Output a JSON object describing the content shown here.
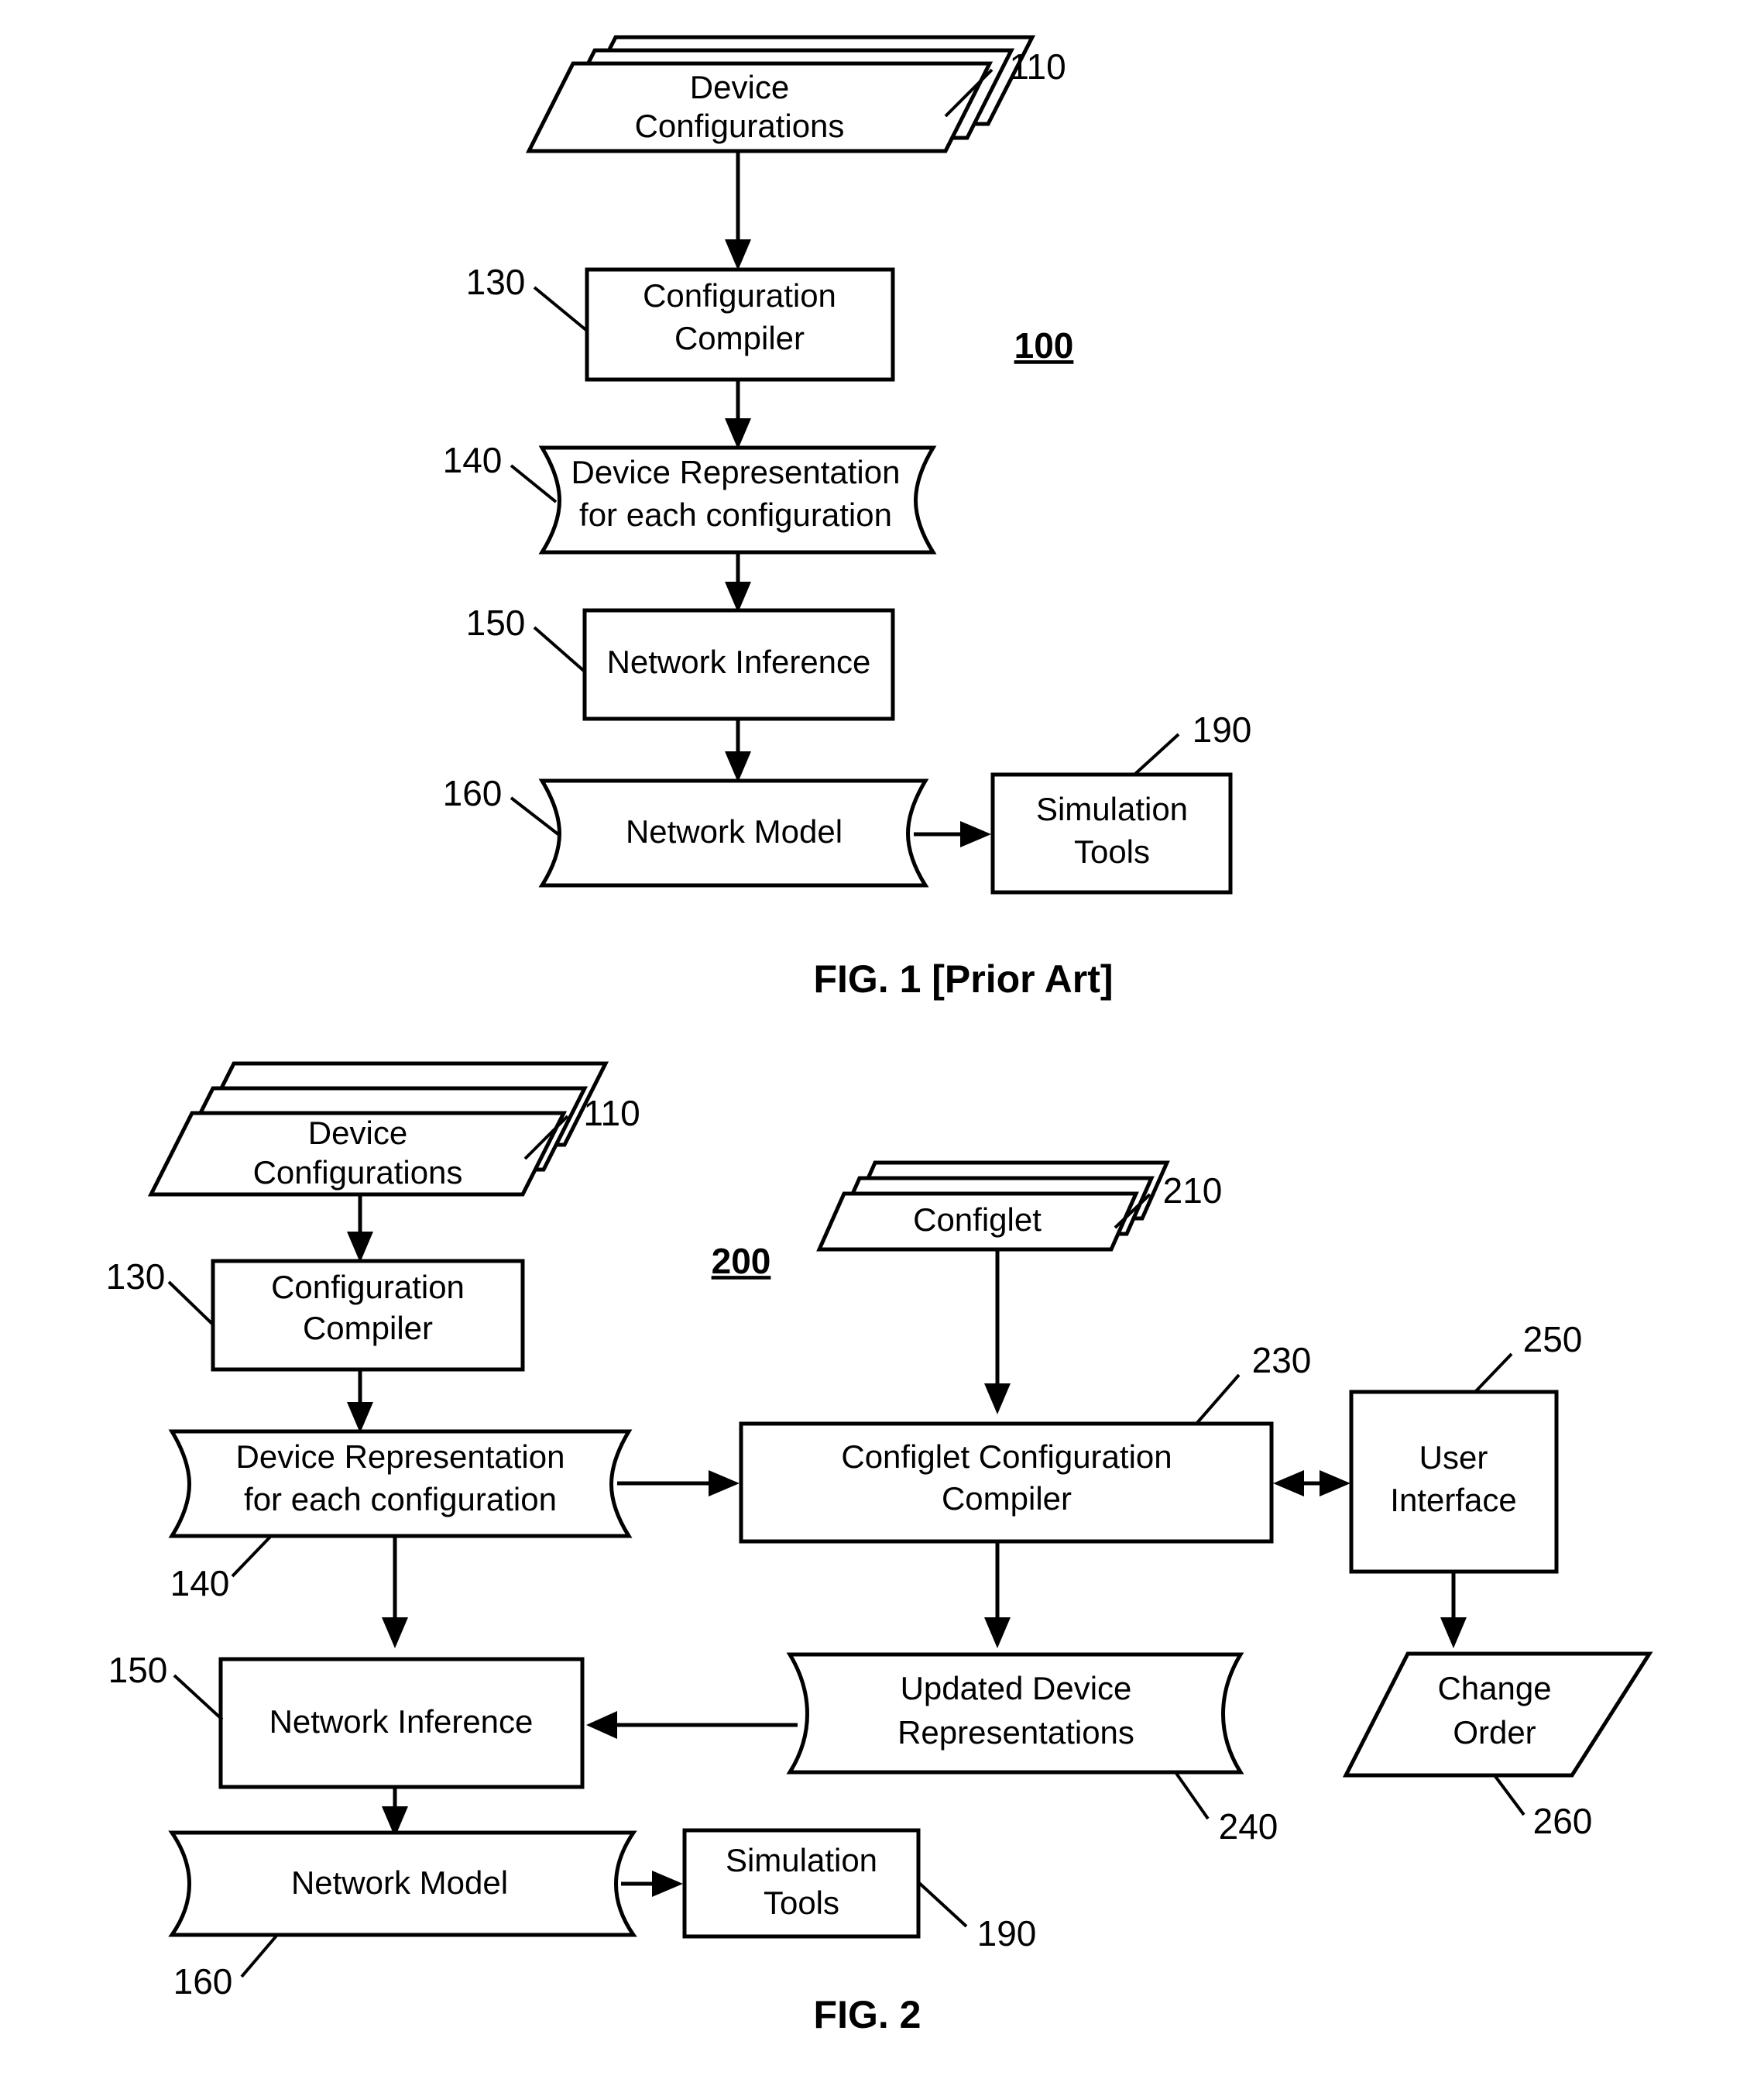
{
  "document": {
    "type": "patent-drawing-sheet",
    "figures": [
      {
        "id": "fig1",
        "caption": "FIG. 1   [Prior Art]",
        "system_number": "100",
        "nodes": [
          {
            "ref": "110",
            "label_line1": "Device",
            "label_line2": "Configurations",
            "shape": "stacked-parallelogram"
          },
          {
            "ref": "130",
            "label_line1": "Configuration",
            "label_line2": "Compiler",
            "shape": "rectangle"
          },
          {
            "ref": "140",
            "label_line1": "Device Representation",
            "label_line2": "for each configuration",
            "shape": "ribbon"
          },
          {
            "ref": "150",
            "label_line1": "Network Inference",
            "label_line2": "",
            "shape": "rectangle"
          },
          {
            "ref": "160",
            "label_line1": "Network Model",
            "label_line2": "",
            "shape": "ribbon"
          },
          {
            "ref": "190",
            "label_line1": "Simulation",
            "label_line2": "Tools",
            "shape": "rectangle"
          }
        ],
        "edges": [
          {
            "from": "110",
            "to": "130",
            "style": "arrow-down"
          },
          {
            "from": "130",
            "to": "140",
            "style": "arrow-down"
          },
          {
            "from": "140",
            "to": "150",
            "style": "arrow-down"
          },
          {
            "from": "150",
            "to": "160",
            "style": "arrow-down"
          },
          {
            "from": "160",
            "to": "190",
            "style": "arrow-right"
          }
        ]
      },
      {
        "id": "fig2",
        "caption": "FIG. 2",
        "system_number": "200",
        "nodes": [
          {
            "ref": "110",
            "label_line1": "Device",
            "label_line2": "Configurations",
            "shape": "stacked-parallelogram"
          },
          {
            "ref": "130",
            "label_line1": "Configuration",
            "label_line2": "Compiler",
            "shape": "rectangle"
          },
          {
            "ref": "140",
            "label_line1": "Device Representation",
            "label_line2": "for each configuration",
            "shape": "ribbon"
          },
          {
            "ref": "210",
            "label_line1": "Configlet",
            "label_line2": "",
            "shape": "stacked-parallelogram"
          },
          {
            "ref": "230",
            "label_line1": "Configlet Configuration",
            "label_line2": "Compiler",
            "shape": "rectangle"
          },
          {
            "ref": "250",
            "label_line1": "User",
            "label_line2": "Interface",
            "shape": "rectangle"
          },
          {
            "ref": "240",
            "label_line1": "Updated Device",
            "label_line2": "Representations",
            "shape": "ribbon"
          },
          {
            "ref": "260",
            "label_line1": "Change",
            "label_line2": "Order",
            "shape": "parallelogram"
          },
          {
            "ref": "150",
            "label_line1": "Network Inference",
            "label_line2": "",
            "shape": "rectangle"
          },
          {
            "ref": "160",
            "label_line1": "Network Model",
            "label_line2": "",
            "shape": "ribbon"
          },
          {
            "ref": "190",
            "label_line1": "Simulation",
            "label_line2": "Tools",
            "shape": "rectangle"
          }
        ],
        "edges": [
          {
            "from": "110",
            "to": "130",
            "style": "arrow-down"
          },
          {
            "from": "130",
            "to": "140",
            "style": "arrow-down"
          },
          {
            "from": "140",
            "to": "230",
            "style": "arrow-right"
          },
          {
            "from": "140",
            "to": "150",
            "style": "arrow-down"
          },
          {
            "from": "210",
            "to": "230",
            "style": "arrow-down"
          },
          {
            "from": "230",
            "to": "250",
            "style": "arrow-double-horizontal"
          },
          {
            "from": "230",
            "to": "240",
            "style": "arrow-down"
          },
          {
            "from": "240",
            "to": "150",
            "style": "arrow-left"
          },
          {
            "from": "250",
            "to": "260",
            "style": "arrow-down"
          },
          {
            "from": "150",
            "to": "160",
            "style": "arrow-down"
          },
          {
            "from": "160",
            "to": "190",
            "style": "arrow-right"
          }
        ]
      }
    ]
  },
  "fig1": {
    "caption": "FIG. 1   [Prior Art]",
    "system_number": "100",
    "device_configurations_l1": "Device",
    "device_configurations_l2": "Configurations",
    "ref_110": "110",
    "configuration_compiler_l1": "Configuration",
    "configuration_compiler_l2": "Compiler",
    "ref_130": "130",
    "device_representation_l1": "Device Representation",
    "device_representation_l2": "for each configuration",
    "ref_140": "140",
    "network_inference": "Network Inference",
    "ref_150": "150",
    "network_model": "Network Model",
    "ref_160": "160",
    "simulation_tools_l1": "Simulation",
    "simulation_tools_l2": "Tools",
    "ref_190": "190"
  },
  "fig2": {
    "caption": "FIG. 2",
    "system_number": "200",
    "device_configurations_l1": "Device",
    "device_configurations_l2": "Configurations",
    "ref_110": "110",
    "configuration_compiler_l1": "Configuration",
    "configuration_compiler_l2": "Compiler",
    "ref_130": "130",
    "device_representation_l1": "Device Representation",
    "device_representation_l2": "for each configuration",
    "ref_140": "140",
    "configlet": "Configlet",
    "ref_210": "210",
    "configlet_compiler_l1": "Configlet Configuration",
    "configlet_compiler_l2": "Compiler",
    "ref_230": "230",
    "user_interface_l1": "User",
    "user_interface_l2": "Interface",
    "ref_250": "250",
    "updated_device_reps_l1": "Updated Device",
    "updated_device_reps_l2": "Representations",
    "ref_240": "240",
    "change_order_l1": "Change",
    "change_order_l2": "Order",
    "ref_260": "260",
    "network_inference": "Network Inference",
    "ref_150": "150",
    "network_model": "Network Model",
    "ref_160": "160",
    "simulation_tools_l1": "Simulation",
    "simulation_tools_l2": "Tools",
    "ref_190": "190"
  }
}
